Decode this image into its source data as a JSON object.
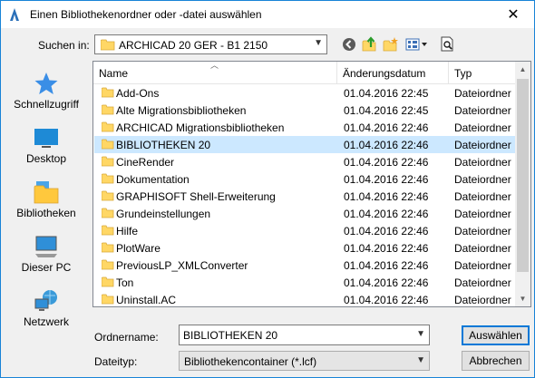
{
  "window": {
    "title": "Einen Bibliothekenordner oder -datei auswählen"
  },
  "lookin": {
    "label": "Suchen in:",
    "value": "ARCHICAD 20 GER - B1 2150"
  },
  "toolbar": {
    "icons": [
      "back-icon",
      "up-folder-icon",
      "new-folder-icon",
      "view-menu-icon",
      "preview-icon"
    ]
  },
  "places": [
    {
      "label": "Schnellzugriff",
      "icon": "quick-access-star-icon"
    },
    {
      "label": "Desktop",
      "icon": "desktop-icon"
    },
    {
      "label": "Bibliotheken",
      "icon": "libraries-icon"
    },
    {
      "label": "Dieser PC",
      "icon": "this-pc-icon"
    },
    {
      "label": "Netzwerk",
      "icon": "network-icon"
    }
  ],
  "list": {
    "columns": [
      "Name",
      "Änderungsdatum",
      "Typ"
    ],
    "rows": [
      {
        "name": "Add-Ons",
        "date": "01.04.2016 22:45",
        "type": "Dateiordner"
      },
      {
        "name": "Alte Migrationsbibliotheken",
        "date": "01.04.2016 22:45",
        "type": "Dateiordner"
      },
      {
        "name": "ARCHICAD Migrationsbibliotheken",
        "date": "01.04.2016 22:46",
        "type": "Dateiordner"
      },
      {
        "name": "BIBLIOTHEKEN 20",
        "date": "01.04.2016 22:46",
        "type": "Dateiordner",
        "selected": true
      },
      {
        "name": "CineRender",
        "date": "01.04.2016 22:46",
        "type": "Dateiordner"
      },
      {
        "name": "Dokumentation",
        "date": "01.04.2016 22:46",
        "type": "Dateiordner"
      },
      {
        "name": "GRAPHISOFT Shell-Erweiterung",
        "date": "01.04.2016 22:46",
        "type": "Dateiordner"
      },
      {
        "name": "Grundeinstellungen",
        "date": "01.04.2016 22:46",
        "type": "Dateiordner"
      },
      {
        "name": "Hilfe",
        "date": "01.04.2016 22:46",
        "type": "Dateiordner"
      },
      {
        "name": "PlotWare",
        "date": "01.04.2016 22:46",
        "type": "Dateiordner"
      },
      {
        "name": "PreviousLP_XMLConverter",
        "date": "01.04.2016 22:46",
        "type": "Dateiordner"
      },
      {
        "name": "Ton",
        "date": "01.04.2016 22:46",
        "type": "Dateiordner"
      },
      {
        "name": "Uninstall.AC",
        "date": "01.04.2016 22:46",
        "type": "Dateiordner"
      }
    ]
  },
  "filename": {
    "label": "Ordnername:",
    "value": "BIBLIOTHEKEN 20"
  },
  "filetype": {
    "label": "Dateityp:",
    "value": "Bibliothekencontainer (*.lcf)"
  },
  "buttons": {
    "ok": "Auswählen",
    "cancel": "Abbrechen"
  },
  "colors": {
    "selection": "#cce8ff",
    "window_border": "#1883d7",
    "folder_yellow": "#ffd765"
  }
}
